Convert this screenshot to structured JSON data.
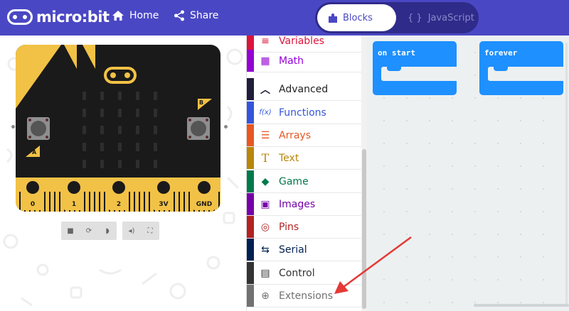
{
  "header": {
    "logo_text": "micro:bit",
    "home_label": "Home",
    "share_label": "Share",
    "blocks_label": "Blocks",
    "javascript_label": "JavaScript",
    "javascript_icon": "{ }"
  },
  "simulator": {
    "button_a": "A",
    "button_b": "B",
    "pins": [
      "0",
      "1",
      "2",
      "3V",
      "GND"
    ],
    "controls": [
      "stop",
      "restart",
      "slow-motion",
      "mute",
      "fullscreen"
    ]
  },
  "toolbox": {
    "items": [
      {
        "label": "Variables",
        "color": "#dc143c",
        "icon": "≡"
      },
      {
        "label": "Math",
        "color": "#9400d3",
        "icon": "▦"
      },
      {
        "label": "Advanced",
        "color": "#1e1e3a",
        "icon": "︿"
      },
      {
        "label": "Functions",
        "color": "#3455db",
        "icon": "f(x)"
      },
      {
        "label": "Arrays",
        "color": "#e65722",
        "icon": "☰"
      },
      {
        "label": "Text",
        "color": "#b8860b",
        "icon": "T"
      },
      {
        "label": "Game",
        "color": "#007a4b",
        "icon": "◆"
      },
      {
        "label": "Images",
        "color": "#7600a8",
        "icon": "▣"
      },
      {
        "label": "Pins",
        "color": "#b22222",
        "icon": "◎"
      },
      {
        "label": "Serial",
        "color": "#002050",
        "icon": "⇆"
      },
      {
        "label": "Control",
        "color": "#333333",
        "icon": "▤"
      },
      {
        "label": "Extensions",
        "color": "#717171",
        "icon": "⊕"
      }
    ]
  },
  "workspace": {
    "on_start_label": "on start",
    "forever_label": "forever"
  }
}
